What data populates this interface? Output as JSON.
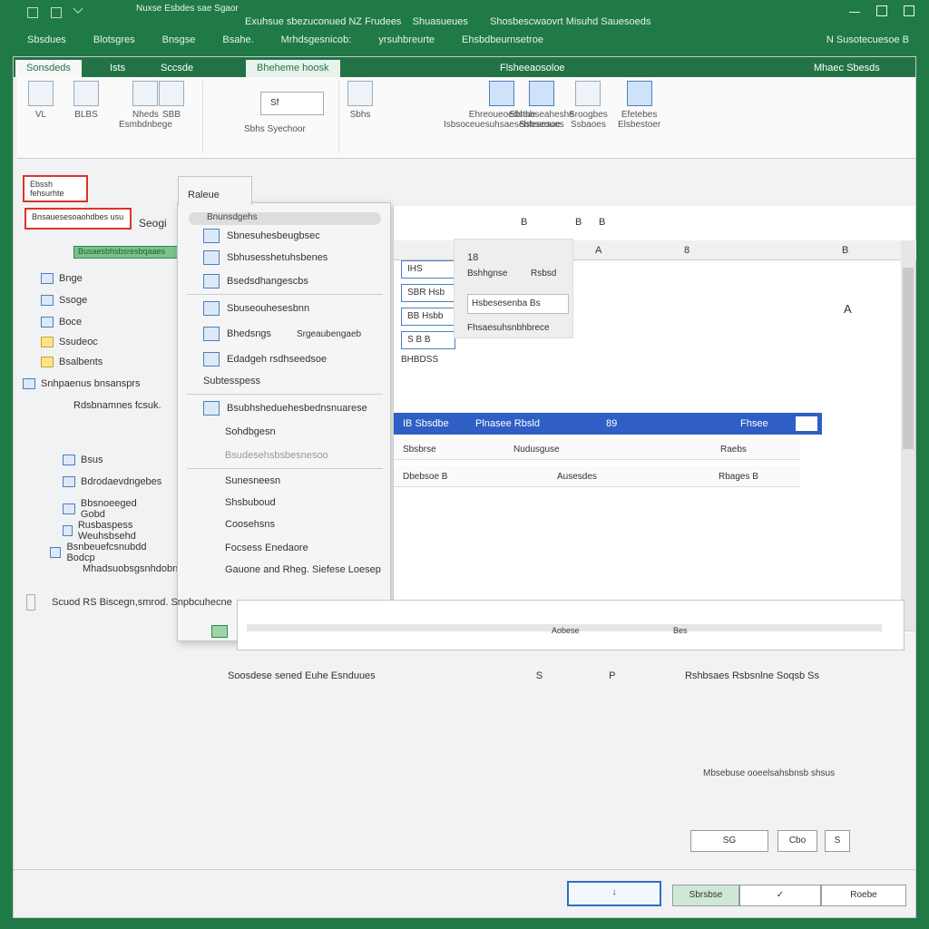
{
  "titlebar": {
    "doc_title": "Nuxse Esbdes sae Sgaor",
    "title_line": "Exuhsue sbezuconued NZ Frudees",
    "title_line_b": "Shuasueues",
    "title_right": "Shosbescwaovrt Misuhd Sauesoeds",
    "menu": [
      "Sbsdues",
      "Blotsgres",
      "Bnsgse",
      "Bsahe.",
      "Mrhdsgesnicob:",
      "yrsuhbreurte",
      "Ehsbdbeurnsetroe"
    ],
    "menu_right": "N Susotecuesoe B"
  },
  "tabs": [
    {
      "label": "Sonsdeds"
    },
    {
      "label": "Ists"
    },
    {
      "label": "Sccsde"
    },
    {
      "label": "Bheheme hoosk"
    },
    {
      "label": "Flsheeaosoloe"
    },
    {
      "label": "Mhaec Sbesds"
    }
  ],
  "ribbon": {
    "input_value": "Sf",
    "groups": [
      {
        "label1": "Nheds",
        "label2": "Esmbdnbege"
      },
      {
        "label1": "",
        "label2": "Sbhs  Syechoor"
      },
      {
        "label1": "Ehreoueoedsthe",
        "label2": "Isbsoceuesuhsaesebtesesoe"
      },
      {
        "label1": "Sbhsbseaheshe",
        "label2": "Ssbseoues"
      },
      {
        "label1": "Sroogbes",
        "label2": "Ssbaoes"
      },
      {
        "label1": "Efetebes",
        "label2": "Elsbestoer"
      }
    ],
    "small_labels": [
      "VL",
      "BLBS",
      "SBB",
      "Sbhs"
    ]
  },
  "left_panel": {
    "highlight_top": "Ebssh fehsurhte",
    "highlight_bottom": "Bnsauesesoaohdbes usu",
    "label_side": "Seogi",
    "green_row": "Busaesbhsbsresbqaaes",
    "items": [
      "Bnge",
      "Ssoge",
      "Boce",
      "Ssudeoc",
      "Bsalbents",
      "Snhpaenus bnsansprs",
      "Rdsbnamnes fcsuk."
    ],
    "items2": [
      "Bsus",
      "Bdrodaevdngebes",
      "Bbsnoeeged Gobd",
      "Rusbaspess Weuhsbsehd",
      "Bsnbeuefcsnubdd Bodcp",
      "Mhadsuobsgsnhdobn"
    ],
    "status": "Scuod RS Biscegn,smrod. Snpbcuhecne"
  },
  "menu": {
    "header": "Raleue",
    "search": "Bnunsdgehs",
    "items": [
      {
        "label": "Sbnesuhesbeugbsec"
      },
      {
        "label": "Sbhusesshetuhsbenes"
      },
      {
        "label": "Bsedsdhangescbs"
      },
      {
        "label": "Sbuseouhesesbnn"
      },
      {
        "label": "Bhedsngs"
      },
      {
        "label": "Edadgeh rsdhseedsoe"
      },
      {
        "label": "Subtesspess"
      },
      {
        "label": "Bsubhsheduehesbednsnuarese"
      },
      {
        "label": "Sohdbgesn"
      },
      {
        "label": "Bsudesehsbsbesnesoo"
      },
      {
        "label": "Sunesneesn"
      },
      {
        "label": "Shsbuboud"
      },
      {
        "label": "Coosehsns"
      },
      {
        "label": "Focsess Enedaore"
      },
      {
        "label": "Gauone and Rheg. Siefese Loesep"
      }
    ],
    "item_extra": "Srgeaubengaeb"
  },
  "sheet": {
    "col_top": [
      "B",
      "B",
      "B"
    ],
    "col_hdr": [
      "A",
      "8",
      "B"
    ],
    "cells": [
      "IHS",
      "SBR Hsb",
      "BB Hsbb",
      "S B B"
    ],
    "cell_foot": "BHBDSS",
    "callout": {
      "num": "18",
      "a": "Bshhgnse",
      "b": "Rsbsd",
      "box": "Hsbesesenba  Bs",
      "c": "Fhsaesuhsnbhbrece"
    },
    "marker": "A",
    "sel": {
      "a": "IB Sbsdbe",
      "b": "Plnasee Rbsld",
      "c": "89",
      "d": "Fhsee"
    },
    "row1": {
      "a": "Sbsbrse",
      "b": "Nudusguse",
      "c": "Raebs"
    },
    "row2": {
      "a": "Dbebsoe  B",
      "b": "Ausesdes",
      "c": "Rbages  B"
    }
  },
  "formula": {
    "a": "Aobese",
    "b": "Bes"
  },
  "info": {
    "left": "Soosdese sened Euhe Esnduues",
    "left_val": "S",
    "mid": "P",
    "right": "Rshbsaes Rsbsnlne Soqsb Ss"
  },
  "hint": "Mbsebuse ooeelsahsbnsb shsus",
  "buttons": {
    "b1": "SG",
    "b2": "Cbo",
    "b3": "S",
    "b4": "Sbrsbse",
    "b5": "",
    "b6": "Roebe"
  },
  "colors": {
    "brand": "#217346",
    "accent": "#2f5fc4",
    "highlight": "#d9342b"
  }
}
